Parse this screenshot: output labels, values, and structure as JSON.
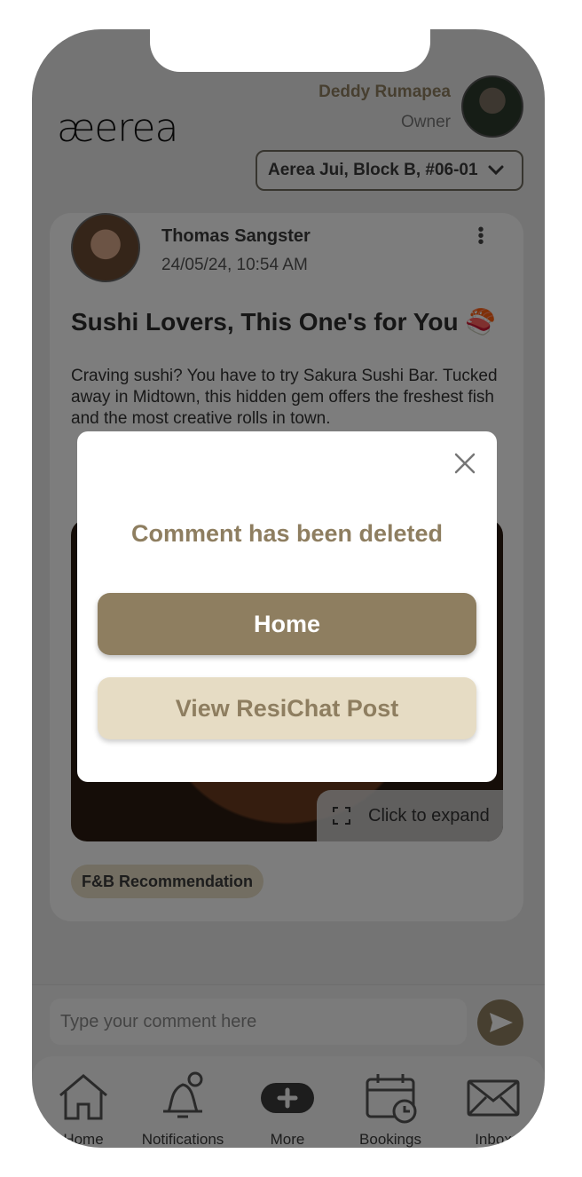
{
  "header": {
    "logo_text": "æerea",
    "user_name": "Deddy Rumapea",
    "user_role": "Owner",
    "unit": "Aerea Jui, Block B, #06-01"
  },
  "post": {
    "author": "Thomas Sangster",
    "timestamp": "24/05/24, 10:54 AM",
    "title": "Sushi Lovers, This One's for You 🍣",
    "body": "Craving sushi? You have to try Sakura Sushi Bar. Tucked away in Midtown, this hidden gem offers the freshest fish and the most creative rolls in town.",
    "expand_label": "Click to expand",
    "tag": "F&B Recommendation"
  },
  "comment": {
    "placeholder": "Type your comment here"
  },
  "nav": {
    "items": [
      {
        "label": "Home",
        "icon": "home-icon"
      },
      {
        "label": "Notifications",
        "icon": "bell-icon"
      },
      {
        "label": "More",
        "icon": "plus-icon"
      },
      {
        "label": "Bookings",
        "icon": "calendar-icon"
      },
      {
        "label": "Inbox",
        "icon": "mail-icon"
      }
    ]
  },
  "modal": {
    "message": "Comment has been deleted",
    "primary_label": "Home",
    "secondary_label": "View ResiChat Post"
  },
  "colors": {
    "accent": "#8e7e60",
    "accent_light": "#e6dcc4"
  }
}
